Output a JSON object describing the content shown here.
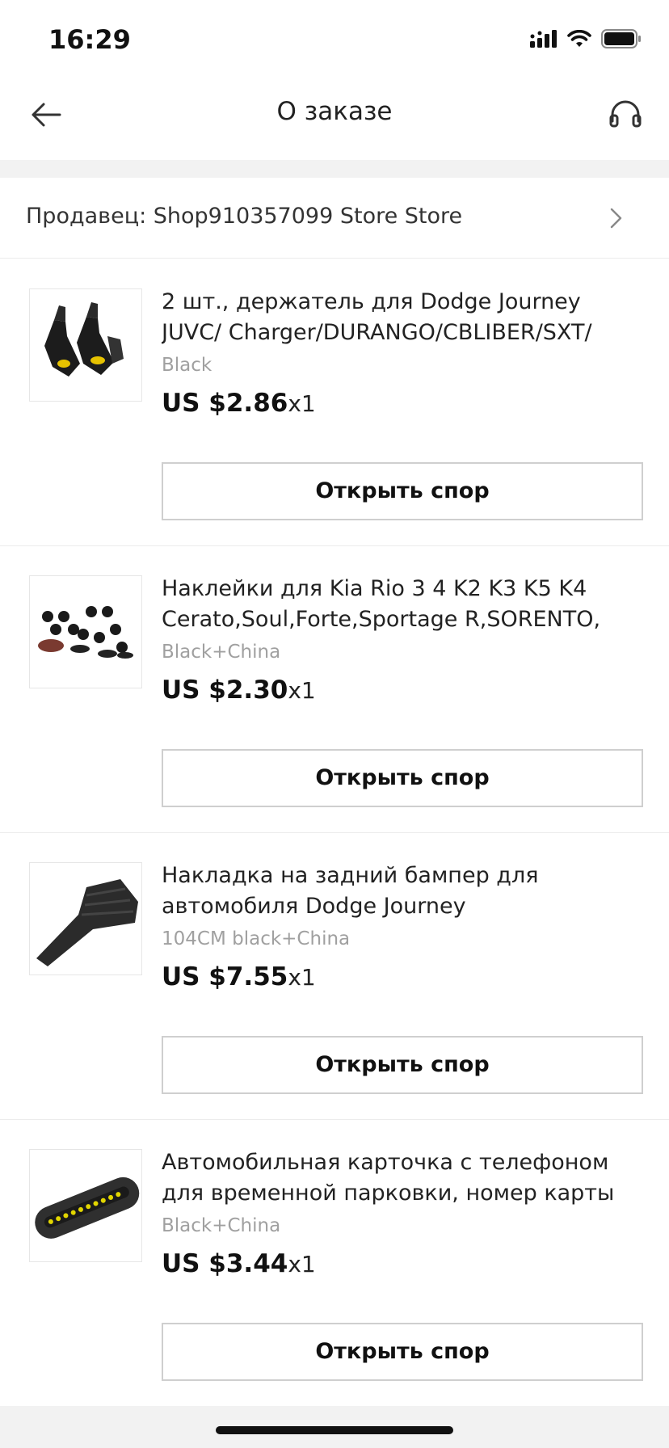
{
  "status_bar": {
    "time": "16:29"
  },
  "header": {
    "title": "О заказе",
    "back_icon": "arrow-left-icon",
    "support_icon": "headset-icon"
  },
  "seller": {
    "label": "Продавец: Shop910357099 Store Store"
  },
  "products": [
    {
      "title": "2 шт., держатель для Dodge Journey JUVC/ Charger/DURANGO/CBLIBER/SXT/Дротика",
      "variant": "Black",
      "price": "US $2.86",
      "qty": "x1",
      "button": "Открыть спор",
      "thumb": "car-hook-holder-image"
    },
    {
      "title": "Наклейки для Kia Rio 3 4 K2 K3 K5 K4 Cerato,Soul,Forte,Sportage R,SORENTO, mo...",
      "variant": "Black+China",
      "price": "US $2.30",
      "qty": "x1",
      "button": "Открыть спор",
      "thumb": "clips-set-image"
    },
    {
      "title": "Накладка на задний бампер для автомобиля Dodge Journey JUVC/Charger/...",
      "variant": "104CM black+China",
      "price": "US $7.55",
      "qty": "x1",
      "button": "Открыть спор",
      "thumb": "rubber-bumper-strip-image"
    },
    {
      "title": "Автомобильная карточка с телефоном для временной парковки, номер карты для Т...",
      "variant": "Black+China",
      "price": "US $3.44",
      "qty": "x1",
      "button": "Открыть спор",
      "thumb": "parking-number-card-image"
    }
  ]
}
